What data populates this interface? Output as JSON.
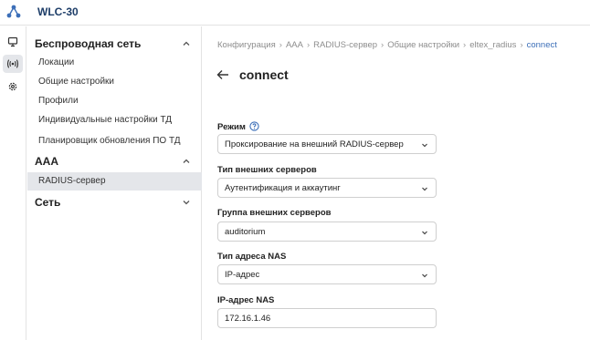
{
  "app": {
    "title": "WLC-30"
  },
  "rail": {
    "items": [
      {
        "icon": "monitor-icon"
      },
      {
        "icon": "wireless-icon"
      },
      {
        "icon": "gear-icon"
      }
    ]
  },
  "nav": {
    "groups": [
      {
        "label": "Беспроводная сеть",
        "expanded": true,
        "items": [
          {
            "label": "Локации"
          },
          {
            "label": "Общие настройки"
          },
          {
            "label": "Профили"
          },
          {
            "label": "Индивидуальные настройки ТД"
          },
          {
            "label": "Планировщик обновления ПО ТД"
          }
        ]
      },
      {
        "label": "AAA",
        "expanded": true,
        "items": [
          {
            "label": "RADIUS-сервер",
            "active": true
          }
        ]
      },
      {
        "label": "Сеть",
        "expanded": false,
        "items": []
      }
    ]
  },
  "breadcrumb": {
    "items": [
      "Конфигурация",
      "AAA",
      "RADIUS-сервер",
      "Общие настройки",
      "eltex_radius"
    ],
    "separator": "›",
    "current": "connect"
  },
  "page": {
    "title": "connect"
  },
  "form": {
    "mode": {
      "label": "Режим",
      "value": "Проксирование на внешний RADIUS-сервер"
    },
    "server_type": {
      "label": "Тип внешних серверов",
      "value": "Аутентификация и аккаутинг"
    },
    "server_group": {
      "label": "Группа внешних серверов",
      "value": "auditorium"
    },
    "nas_address_type": {
      "label": "Тип адреса NAS",
      "value": "IP-адрес"
    },
    "nas_ip": {
      "label": "IP-адрес NAS",
      "value": "172.16.1.46"
    }
  },
  "colors": {
    "accent": "#3c6fb8",
    "title": "#1d3d68",
    "active_bg": "#e4e6ea"
  }
}
